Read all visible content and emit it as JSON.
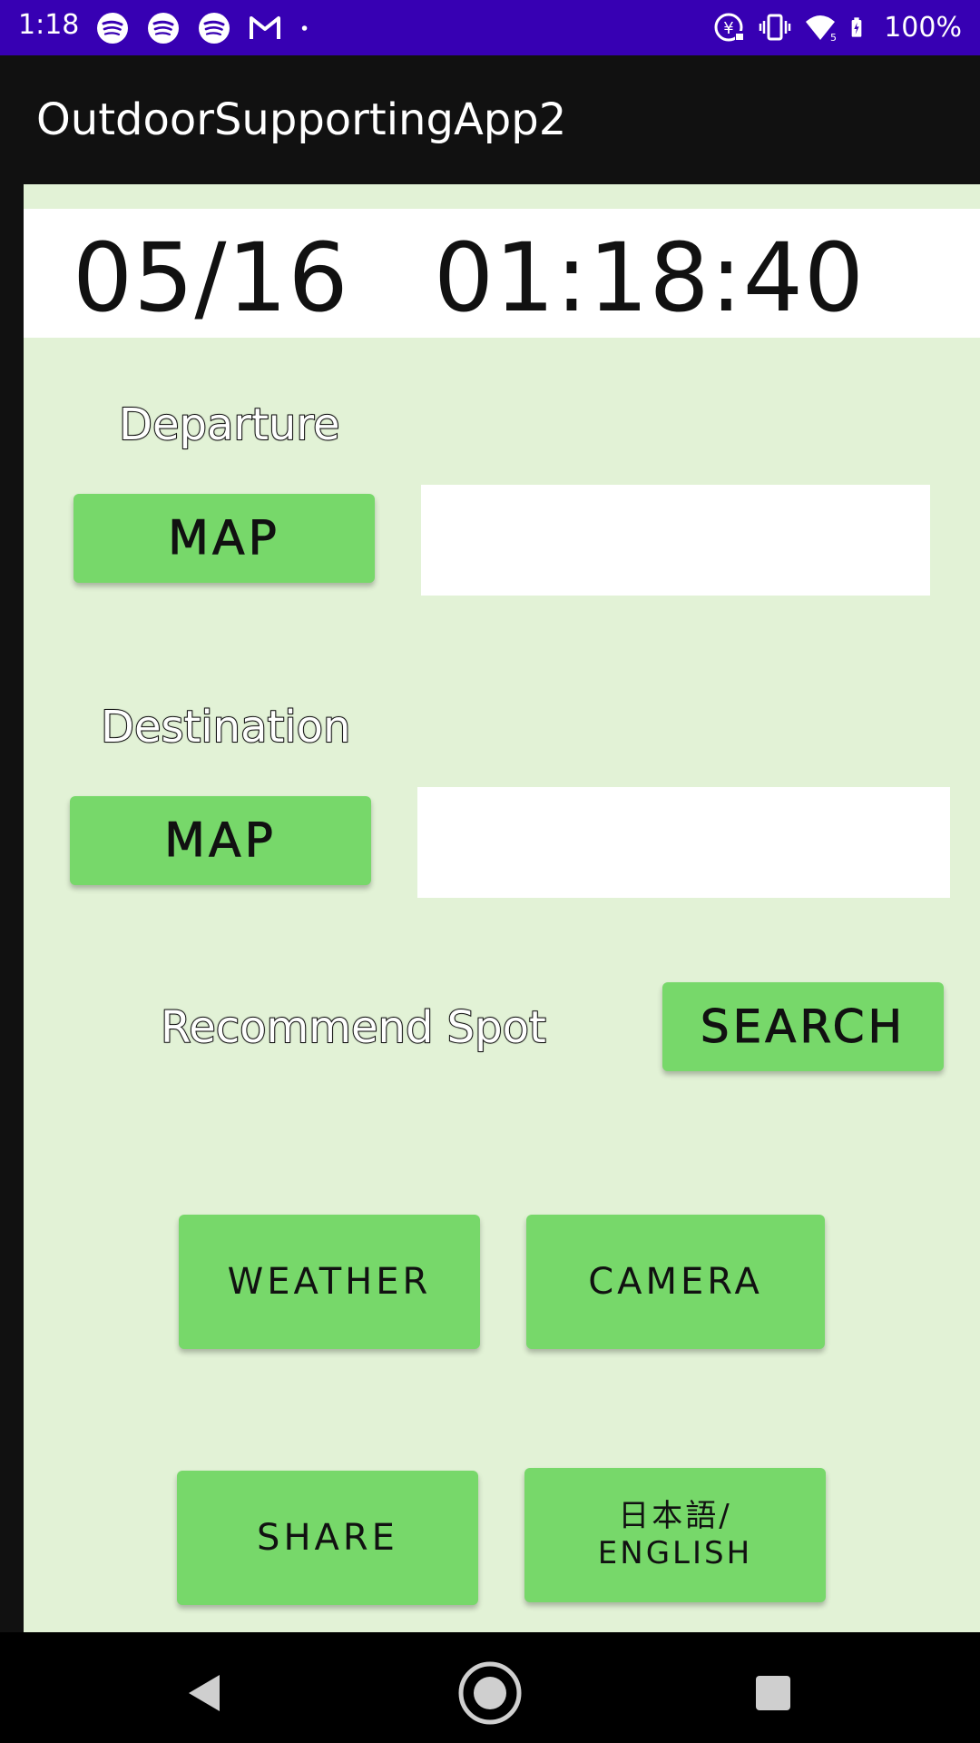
{
  "status_bar": {
    "time": "1:18",
    "battery_percent": "100%",
    "icons_left": [
      "spotify-icon",
      "spotify-icon",
      "spotify-icon",
      "gmail-icon",
      "dot-icon"
    ],
    "icons_right": [
      "data-saver-icon",
      "vibrate-icon",
      "wifi-icon",
      "battery-charging-icon"
    ]
  },
  "app_bar": {
    "title": "OutdoorSupportingApp2"
  },
  "clock": {
    "date": "05/16",
    "time": "01:18:40"
  },
  "departure": {
    "label": "Departure",
    "map_button": "MAP",
    "value": ""
  },
  "destination": {
    "label": "Destination",
    "map_button": "MAP",
    "value": ""
  },
  "recommend": {
    "label": "Recommend Spot",
    "search_button": "SEARCH"
  },
  "actions": {
    "weather": "WEATHER",
    "camera": "CAMERA",
    "share": "SHARE",
    "language_line1": "日本語/",
    "language_line2": "ENGLISH"
  },
  "colors": {
    "status_bar": "#3700b3",
    "app_bar": "#111111",
    "content_bg": "#e2f2d6",
    "button": "#77d86a"
  }
}
